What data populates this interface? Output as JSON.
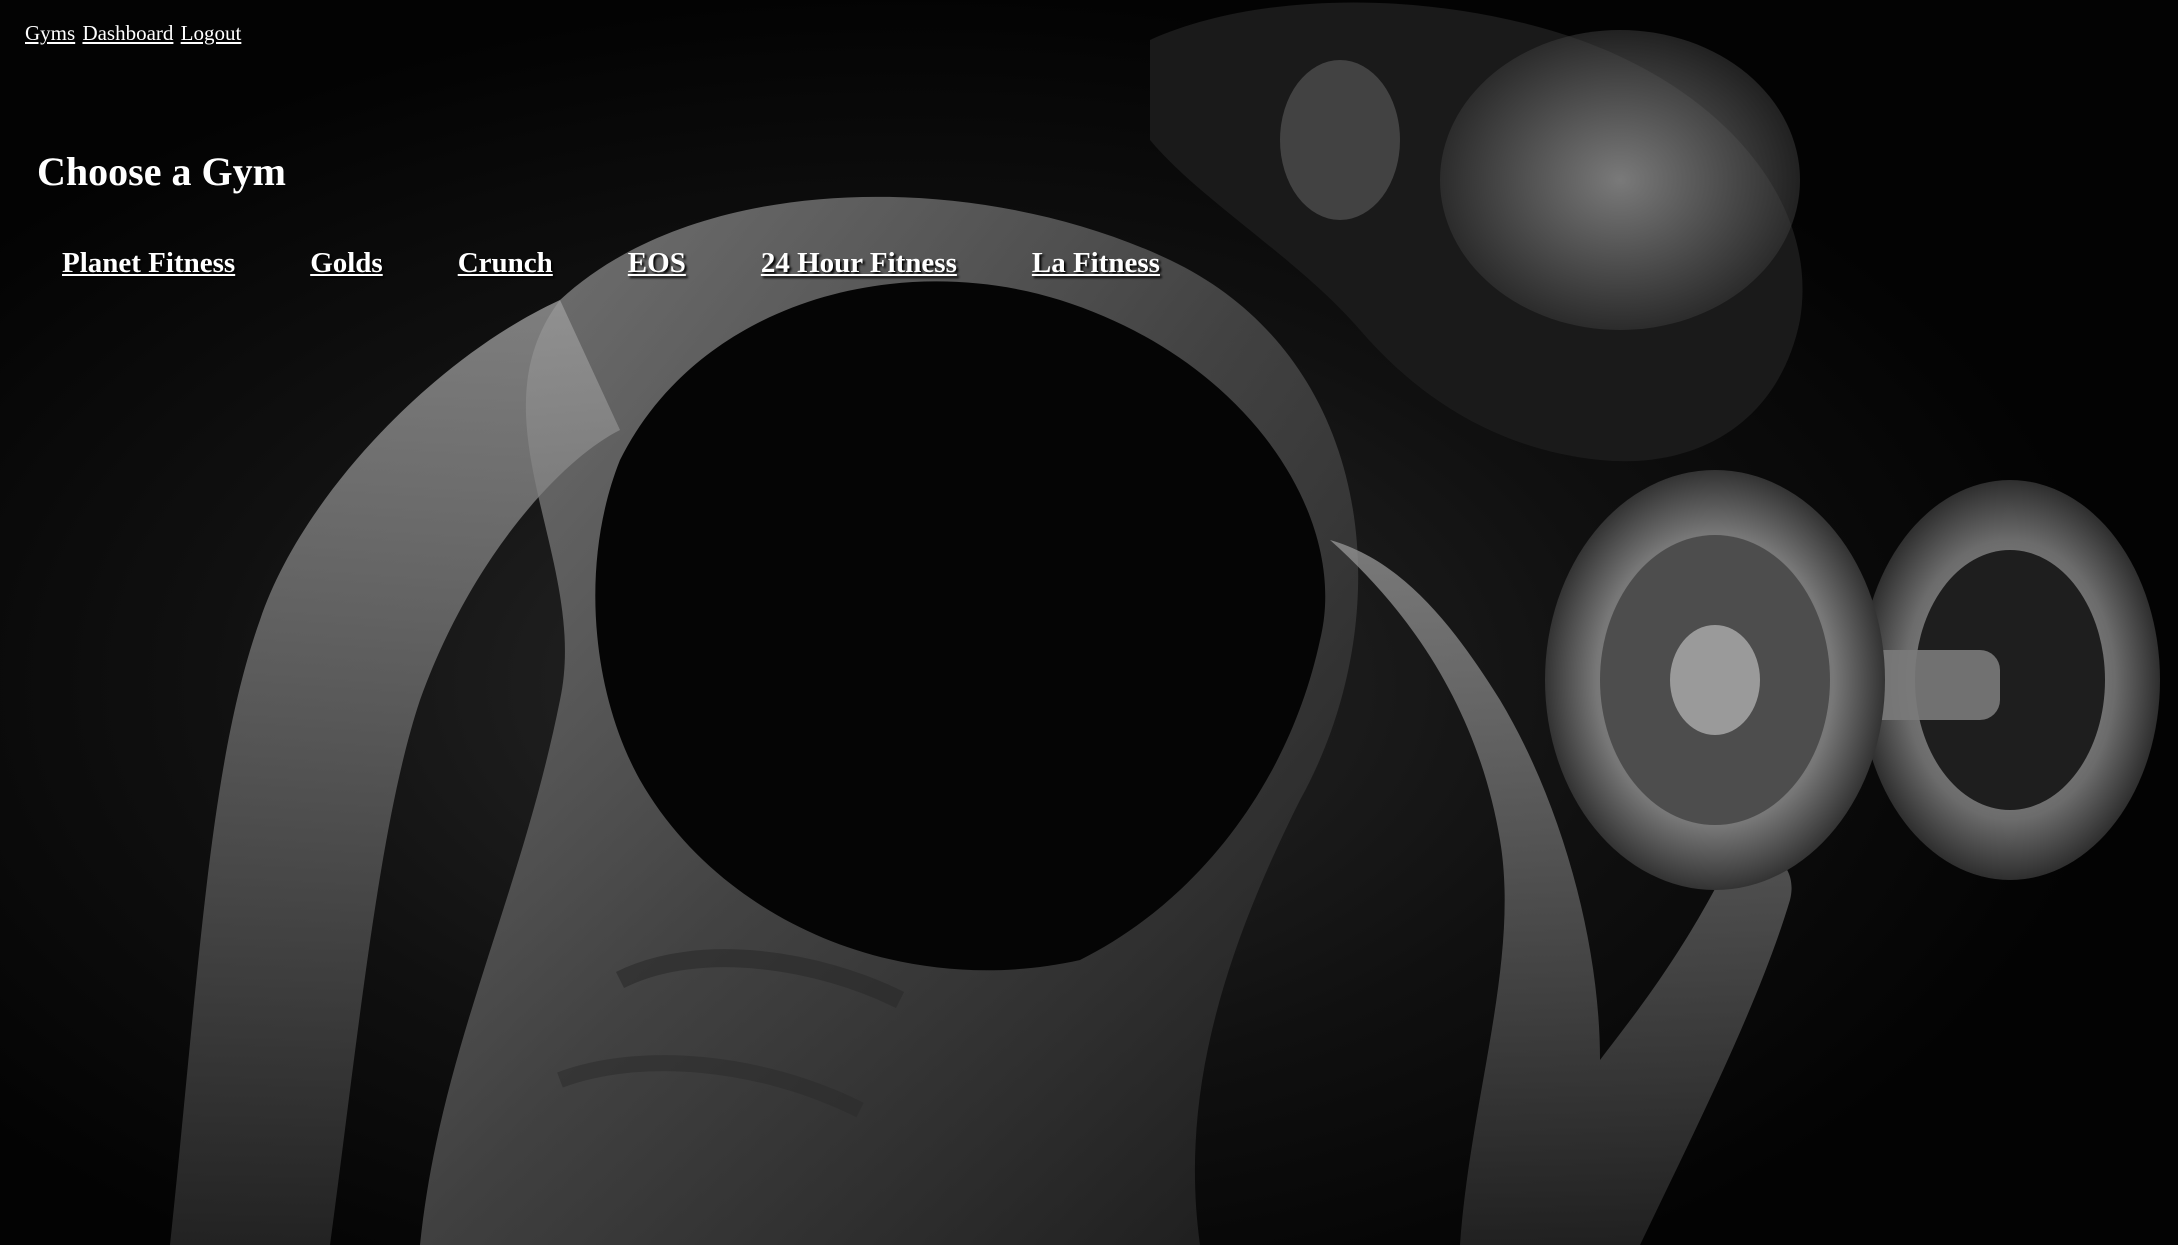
{
  "nav": {
    "links": [
      "Gyms",
      "Dashboard",
      "Logout"
    ]
  },
  "page": {
    "title": "Choose a Gym"
  },
  "gyms": [
    "Planet Fitness",
    "Golds",
    "Crunch",
    "EOS",
    "24 Hour Fitness",
    "La Fitness"
  ],
  "background": {
    "description_icon": "athlete-dumbbell-photo",
    "color": "#000000"
  }
}
